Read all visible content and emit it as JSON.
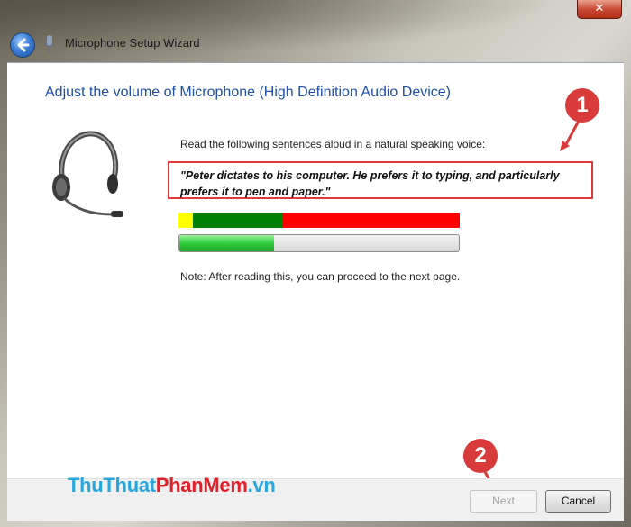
{
  "window": {
    "title": "Microphone Setup Wizard",
    "close_glyph": "✕",
    "back_icon": "back-arrow-icon"
  },
  "wizard": {
    "heading": "Adjust the volume of Microphone (High Definition Audio Device)",
    "instruction": "Read the following sentences aloud in a natural speaking voice:",
    "quote": "\"Peter dictates to his computer. He prefers it to typing, and particularly prefers it to pen and paper.\"",
    "note": "Note: After reading this, you can proceed to the next page.",
    "volume_level": {
      "yellow": 0.05,
      "green": 0.32,
      "red": 0.63
    },
    "progress": 0.34,
    "colors": {
      "heading": "#1f4fa8",
      "yellow": "#ffff00",
      "green": "#008000",
      "red": "#ff0000"
    }
  },
  "buttons": {
    "next": "Next",
    "cancel": "Cancel"
  },
  "annotations": {
    "callout_1": "1",
    "callout_2": "2",
    "color": "#d93a3a"
  },
  "watermark": {
    "part1": "ThuThuat",
    "part2": "PhanMem",
    "part3": ".vn"
  }
}
